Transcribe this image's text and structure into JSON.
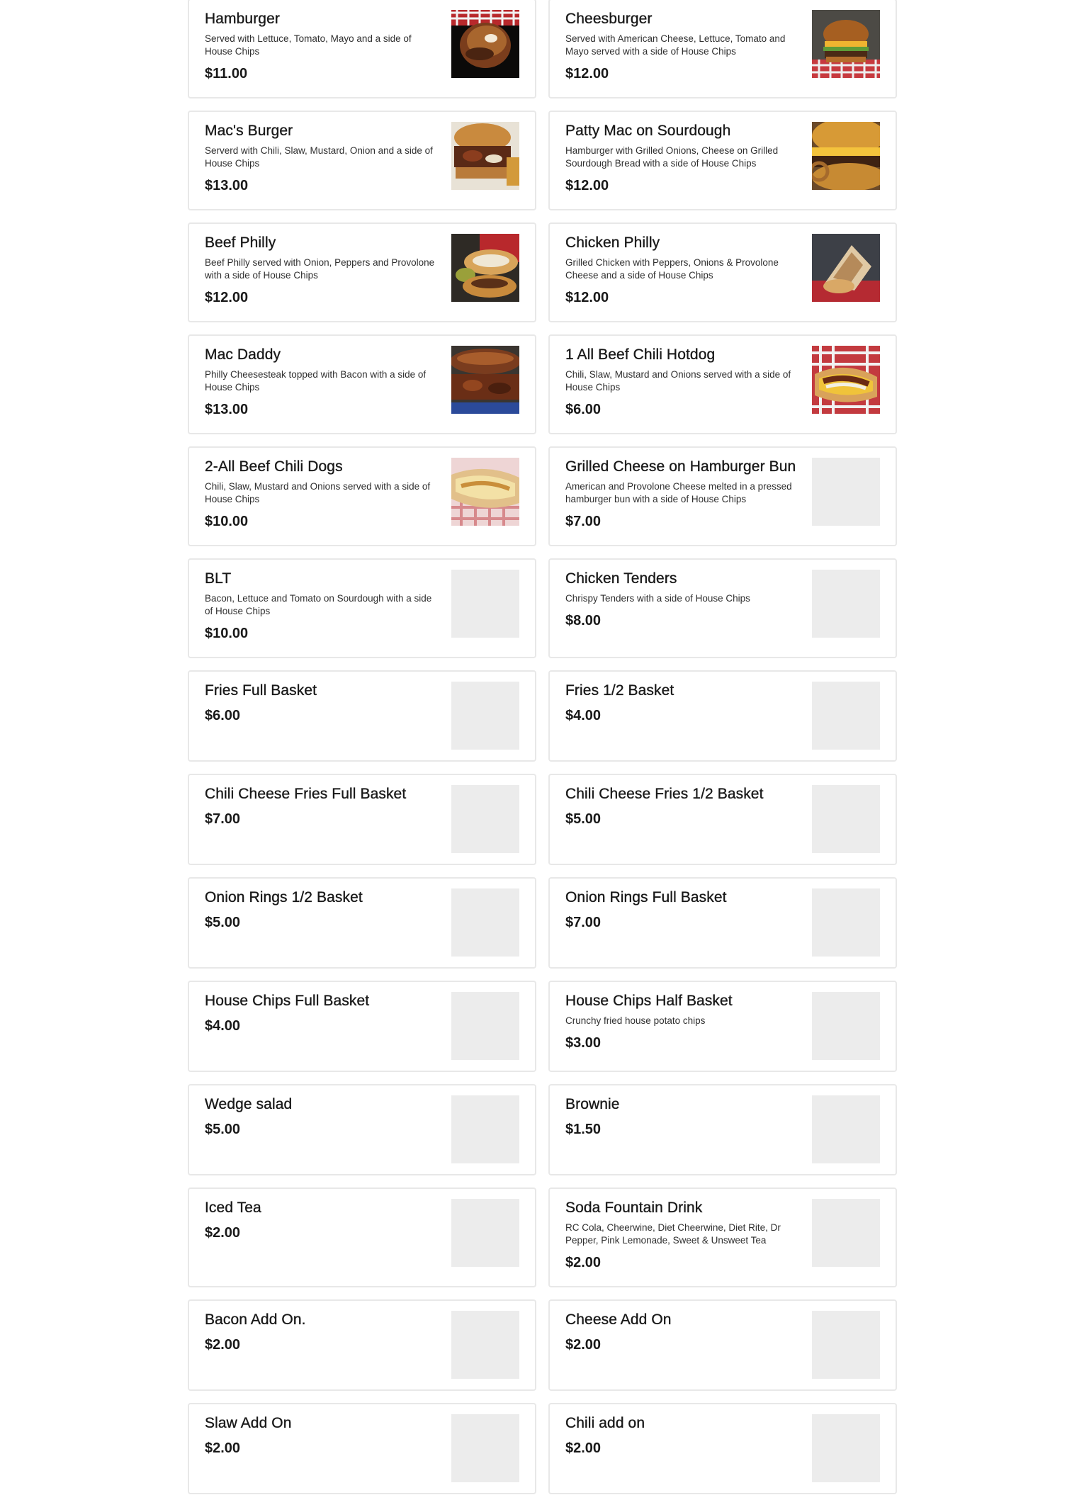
{
  "menu": {
    "items": [
      {
        "name": "Hamburger",
        "description": "Served with Lettuce, Tomato, Mayo and a side of House Chips",
        "price": "$11.00",
        "photo": "burger-photo"
      },
      {
        "name": "Cheesburger",
        "description": "Served with American Cheese, Lettuce, Tomato and Mayo served with a side of House Chips",
        "price": "$12.00",
        "photo": "cheeseburger-photo"
      },
      {
        "name": "Mac's Burger",
        "description": "Serverd with Chili, Slaw, Mustard, Onion and a side of House Chips",
        "price": "$13.00",
        "photo": "loaded-burger-photo"
      },
      {
        "name": "Patty Mac on Sourdough",
        "description": "Hamburger with Grilled Onions, Cheese on Grilled Sourdough Bread with a side of House Chips",
        "price": "$12.00",
        "photo": "patty-melt-photo"
      },
      {
        "name": "Beef Philly",
        "description": "Beef Philly served with Onion, Peppers and Provolone with a side of House Chips",
        "price": "$12.00",
        "photo": "philly-photo"
      },
      {
        "name": "Chicken Philly",
        "description": "Grilled Chicken with Peppers, Onions & Provolone Cheese and a side of House Chips",
        "price": "$12.00",
        "photo": "chicken-philly-photo"
      },
      {
        "name": "Mac Daddy",
        "description": "Philly Cheesesteak topped with Bacon with a side of House Chips",
        "price": "$13.00",
        "photo": "cheesesteak-photo"
      },
      {
        "name": "1 All Beef Chili Hotdog",
        "description": "Chili, Slaw, Mustard and Onions served with a side of House Chips",
        "price": "$6.00",
        "photo": "hotdog-photo"
      },
      {
        "name": "2-All Beef Chili Dogs",
        "description": "Chili, Slaw, Mustard and Onions served with a side of House Chips",
        "price": "$10.00",
        "photo": "hotdogs-photo"
      },
      {
        "name": "Grilled Cheese on Hamburger Bun",
        "description": "American and Provolone Cheese melted in a pressed hamburger bun with a side of House Chips",
        "price": "$7.00",
        "photo": ""
      },
      {
        "name": "BLT",
        "description": "Bacon, Lettuce and Tomato on Sourdough with a side of House Chips",
        "price": "$10.00",
        "photo": ""
      },
      {
        "name": "Chicken Tenders",
        "description": "Chrispy Tenders with a side of House Chips",
        "price": "$8.00",
        "photo": ""
      },
      {
        "name": "Fries Full Basket",
        "description": "",
        "price": "$6.00",
        "photo": ""
      },
      {
        "name": "Fries 1/2 Basket",
        "description": "",
        "price": "$4.00",
        "photo": ""
      },
      {
        "name": "Chili Cheese Fries Full Basket",
        "description": "",
        "price": "$7.00",
        "photo": ""
      },
      {
        "name": "Chili Cheese Fries 1/2 Basket",
        "description": "",
        "price": "$5.00",
        "photo": ""
      },
      {
        "name": "Onion Rings 1/2 Basket",
        "description": "",
        "price": "$5.00",
        "photo": ""
      },
      {
        "name": "Onion Rings Full Basket",
        "description": "",
        "price": "$7.00",
        "photo": ""
      },
      {
        "name": "House Chips Full Basket",
        "description": "",
        "price": "$4.00",
        "photo": ""
      },
      {
        "name": "House Chips Half Basket",
        "description": "Crunchy fried house potato chips",
        "price": "$3.00",
        "photo": ""
      },
      {
        "name": "Wedge salad",
        "description": "",
        "price": "$5.00",
        "photo": ""
      },
      {
        "name": "Brownie",
        "description": "",
        "price": "$1.50",
        "photo": ""
      },
      {
        "name": "Iced Tea",
        "description": "",
        "price": "$2.00",
        "photo": ""
      },
      {
        "name": "Soda Fountain Drink",
        "description": "RC Cola, Cheerwine, Diet Cheerwine, Diet Rite, Dr Pepper, Pink Lemonade, Sweet & Unsweet Tea",
        "price": "$2.00",
        "photo": ""
      },
      {
        "name": "Bacon Add On.",
        "description": "",
        "price": "$2.00",
        "photo": ""
      },
      {
        "name": "Cheese Add On",
        "description": "",
        "price": "$2.00",
        "photo": ""
      },
      {
        "name": "Slaw Add On",
        "description": "",
        "price": "$2.00",
        "photo": ""
      },
      {
        "name": "Chili add on",
        "description": "",
        "price": "$2.00",
        "photo": ""
      }
    ]
  },
  "colors": {
    "card_border": "#e8e8e8",
    "text": "#191919",
    "placeholder": "#ececec"
  }
}
